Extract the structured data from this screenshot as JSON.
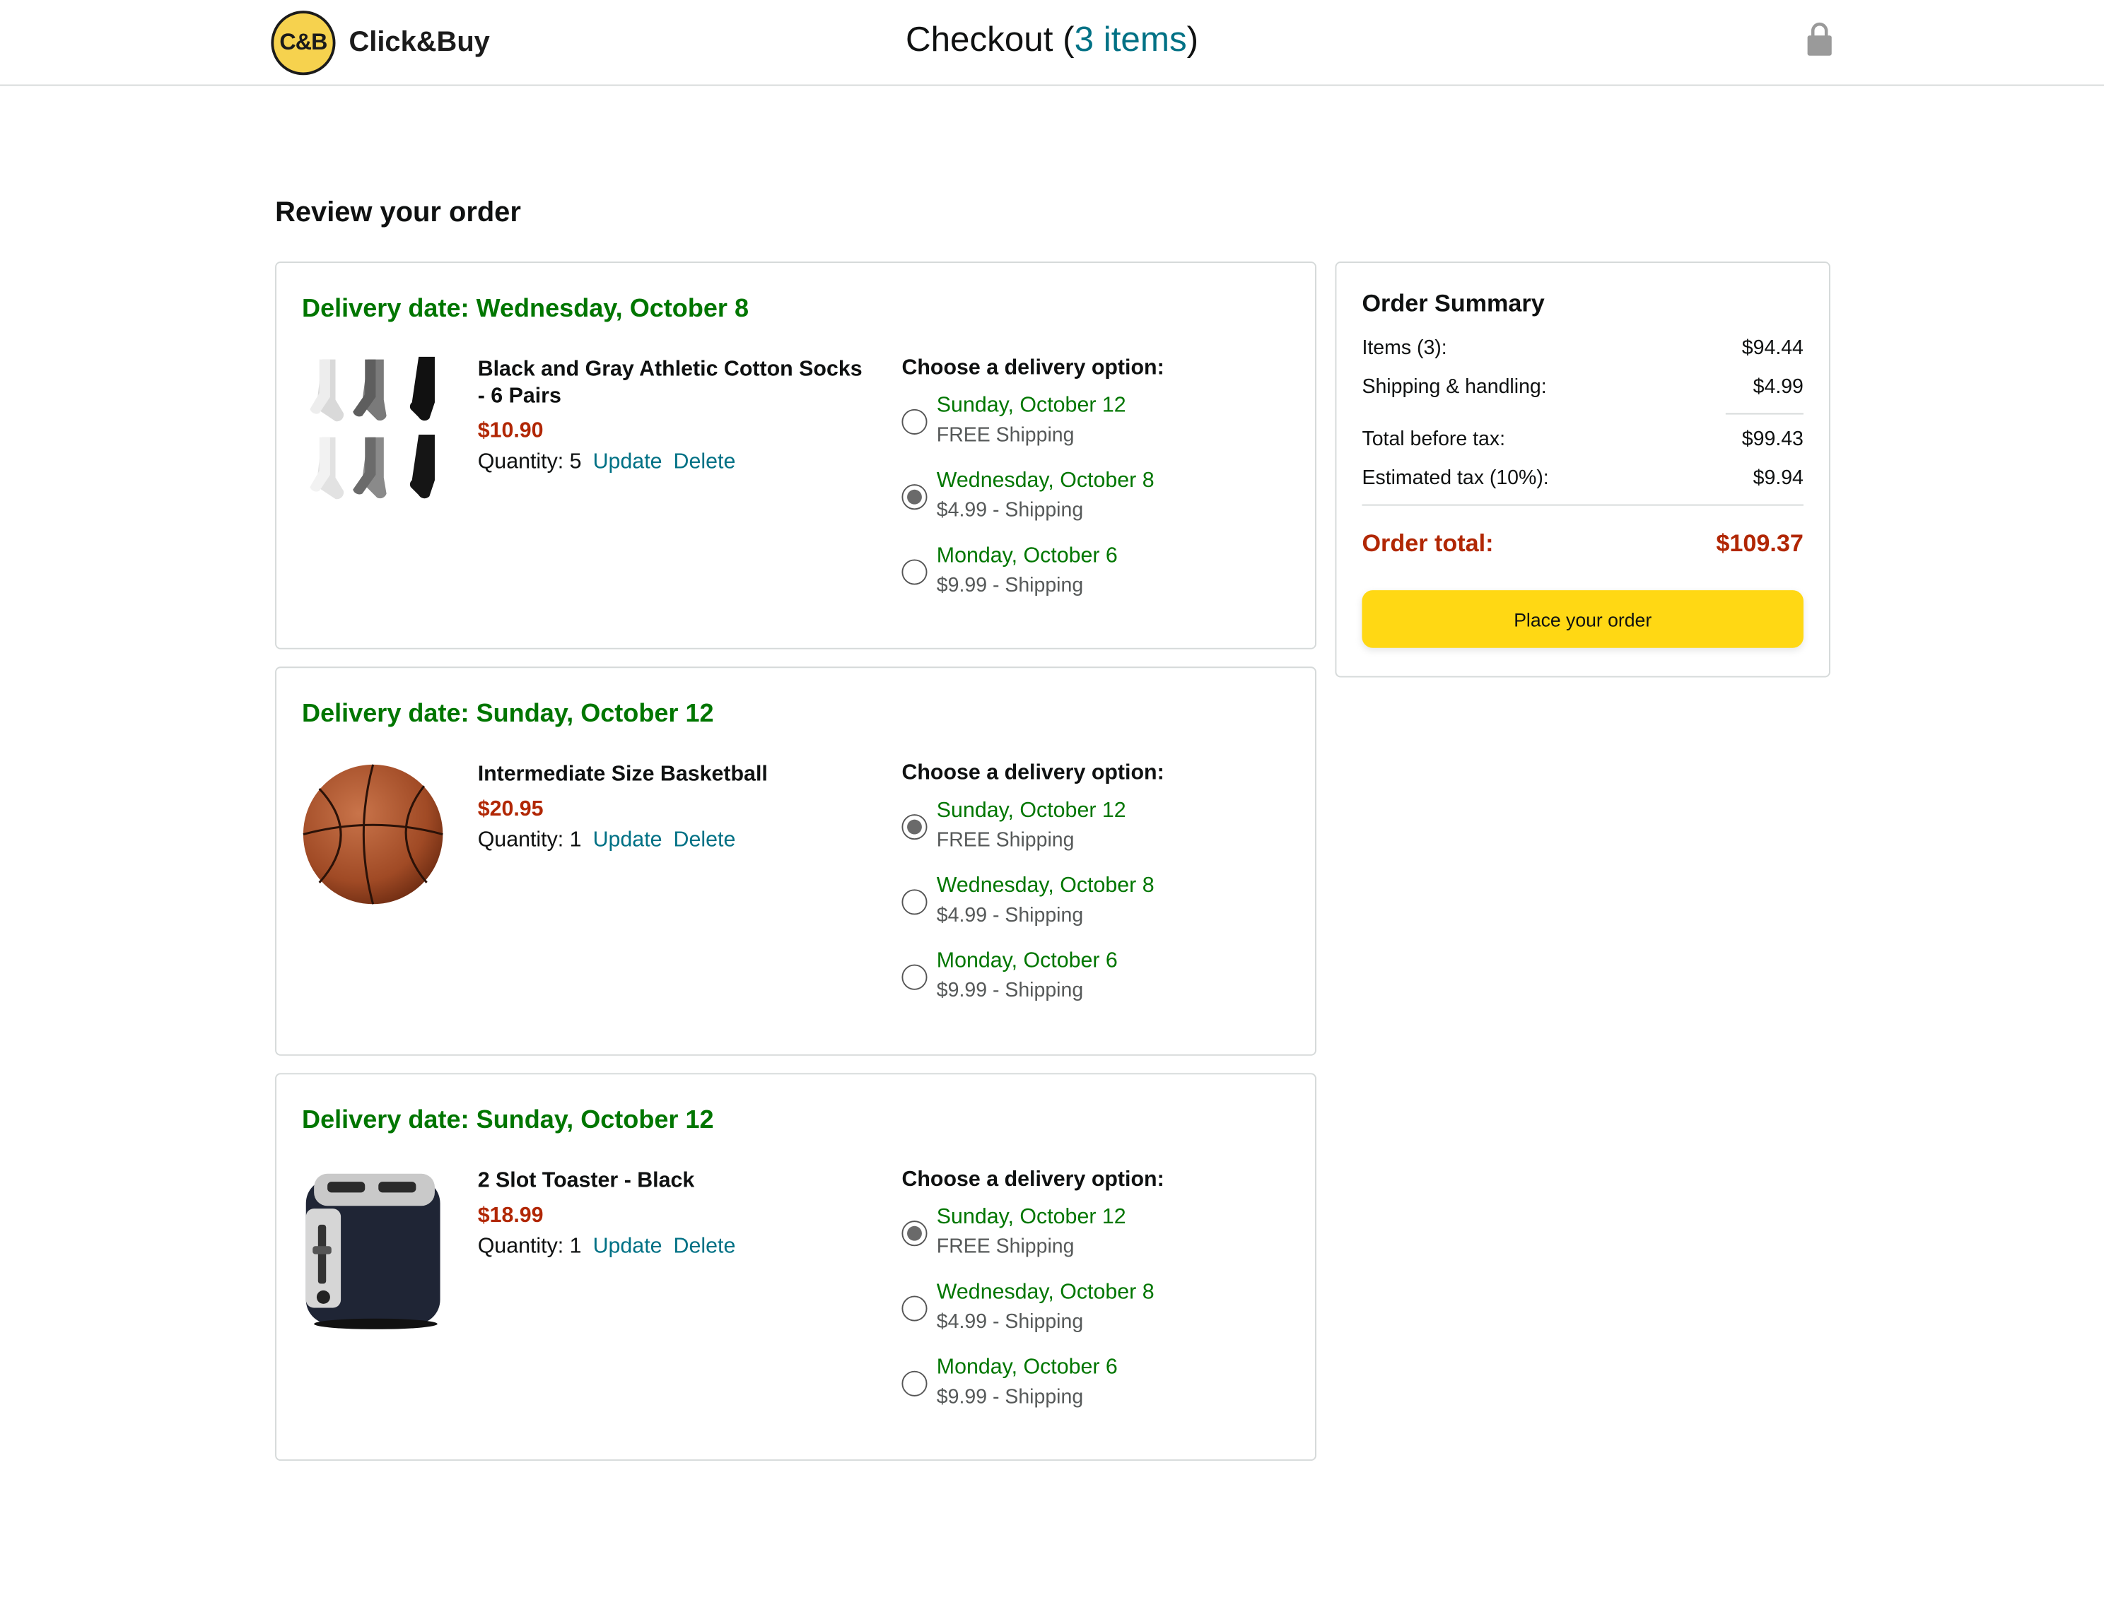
{
  "header": {
    "logo_badge": "C&B",
    "logo_name": "Click&Buy",
    "title_prefix": "Checkout (",
    "title_count": "3 items",
    "title_suffix": ")",
    "lock_icon": "lock-icon"
  },
  "page_heading": "Review your order",
  "colors": {
    "delivery_green": "#007600",
    "price_red": "#b12704",
    "link_teal": "#007185",
    "button_yellow": "#ffd814"
  },
  "items": [
    {
      "delivery_date": "Delivery date: Wednesday, October 8",
      "name": "Black and Gray Athletic Cotton Socks - 6 Pairs",
      "price": "$10.90",
      "quantity": "Quantity: 5",
      "update_label": "Update",
      "delete_label": "Delete",
      "image_icon": "socks-image",
      "options_title": "Choose a delivery option:",
      "options": [
        {
          "date": "Sunday, October 12",
          "price": "FREE Shipping",
          "selected": false
        },
        {
          "date": "Wednesday, October 8",
          "price": "$4.99 - Shipping",
          "selected": true
        },
        {
          "date": "Monday, October 6",
          "price": "$9.99 - Shipping",
          "selected": false
        }
      ]
    },
    {
      "delivery_date": "Delivery date: Sunday, October 12",
      "name": "Intermediate Size Basketball",
      "price": "$20.95",
      "quantity": "Quantity: 1",
      "update_label": "Update",
      "delete_label": "Delete",
      "image_icon": "basketball-image",
      "options_title": "Choose a delivery option:",
      "options": [
        {
          "date": "Sunday, October 12",
          "price": "FREE Shipping",
          "selected": true
        },
        {
          "date": "Wednesday, October 8",
          "price": "$4.99 - Shipping",
          "selected": false
        },
        {
          "date": "Monday, October 6",
          "price": "$9.99 - Shipping",
          "selected": false
        }
      ]
    },
    {
      "delivery_date": "Delivery date: Sunday, October 12",
      "name": "2 Slot Toaster - Black",
      "price": "$18.99",
      "quantity": "Quantity: 1",
      "update_label": "Update",
      "delete_label": "Delete",
      "image_icon": "toaster-image",
      "options_title": "Choose a delivery option:",
      "options": [
        {
          "date": "Sunday, October 12",
          "price": "FREE Shipping",
          "selected": true
        },
        {
          "date": "Wednesday, October 8",
          "price": "$4.99 - Shipping",
          "selected": false
        },
        {
          "date": "Monday, October 6",
          "price": "$9.99 - Shipping",
          "selected": false
        }
      ]
    }
  ],
  "summary": {
    "title": "Order Summary",
    "items_label": "Items (3):",
    "items_value": "$94.44",
    "shipping_label": "Shipping & handling:",
    "shipping_value": "$4.99",
    "before_tax_label": "Total before tax:",
    "before_tax_value": "$99.43",
    "tax_label": "Estimated tax (10%):",
    "tax_value": "$9.94",
    "total_label": "Order total:",
    "total_value": "$109.37",
    "place_order_label": "Place your order"
  }
}
